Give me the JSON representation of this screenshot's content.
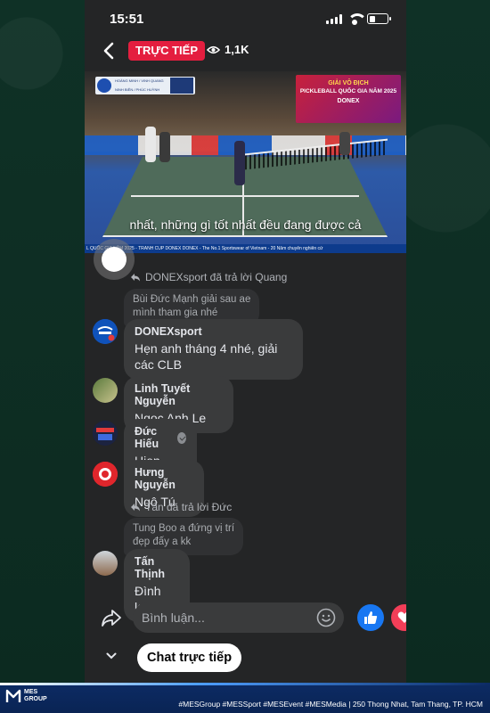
{
  "status_bar": {
    "time": "15:51"
  },
  "top_bar": {
    "live_label": "TRỰC TIẾP",
    "viewer_count": "1,1K"
  },
  "video": {
    "subtitle": "nhất, những gì tốt nhất đều đang được cả",
    "title_card": [
      "GIẢI VÔ ĐỊCH",
      "PICKLEBALL QUỐC GIA NĂM 2025",
      "DONEX"
    ],
    "ticker": "L QUỐC GIA NĂM 2025 - TRANH CUP DONEX    DONEX - The No.1 Sportswear of Vietnam - 20 Năm chuyên nghiên cứ",
    "scoreboard": [
      "HOÀNG MINH / VINH QUANG",
      "NINH BIÊN / PHÚC HUỲNH"
    ]
  },
  "comments": {
    "faded_text": "",
    "reply_1": {
      "label": "DONEXsport đã trả lời Quang",
      "quote": [
        "Bùi Đức Mạnh giải sau ae",
        "mình tham gia nhé"
      ],
      "name": "DONEXsport",
      "message": [
        "Hẹn anh tháng 4 nhé, giải",
        "các CLB"
      ]
    },
    "comment_2": {
      "name": "Linh Tuyết Nguyễn",
      "message": "Ngoc Anh Le"
    },
    "comment_3": {
      "name": "Đức Hiếu",
      "message": "Hien Dao"
    },
    "comment_4": {
      "name": "Hưng Nguyễn",
      "message": "Ngô Tú"
    },
    "reply_5": {
      "label": "Tấn đã trả lời Đức",
      "quote": [
        "Tung Boo  a đứng vị trí",
        "đẹp đấy a kk"
      ],
      "name": "Tấn Thịnh",
      "message": "Đình kao"
    }
  },
  "composer": {
    "placeholder": "Bình luận..."
  },
  "footer": {
    "chat_label": "Chat trực tiếp"
  },
  "brand_band": {
    "logo_text": [
      "MES",
      "GROUP"
    ],
    "text": "#MESGroup #MESSport #MESEvent #MESMedia | 250 Thong Nhat, Tam Thang, TP. HCM"
  },
  "colors": {
    "live_red": "#e41e3f",
    "like_blue": "#1877f2",
    "love_red": "#f33e58",
    "bubble_bg": "#3a3b3c",
    "background_green": "#0e2e22"
  },
  "icons": [
    "back-icon",
    "eye-icon",
    "reply-arrow-icon",
    "verified-icon",
    "share-icon",
    "emoji-icon",
    "like-icon",
    "love-icon",
    "chevron-down-icon"
  ]
}
